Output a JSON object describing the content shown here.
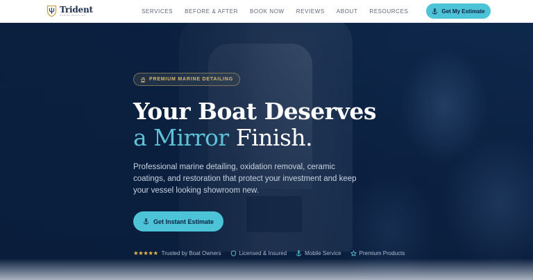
{
  "brand": {
    "name": "Trident",
    "tagline": "MARINE DETAILING"
  },
  "nav": {
    "items": [
      "SERVICES",
      "BEFORE & AFTER",
      "BOOK NOW",
      "REVIEWS",
      "ABOUT",
      "RESOURCES"
    ],
    "cta_label": "Get My Estimate"
  },
  "hero": {
    "badge": "PREMIUM MARINE DETAILING",
    "title_line1": "Your Boat Deserves",
    "title_line2_accent": "a Mirror",
    "title_line2_rest": " Finish.",
    "lead": "Professional marine detailing, oxidation removal, ceramic coatings, and restoration that protect your investment and keep your vessel looking showroom new.",
    "cta_label": "Get Instant Estimate",
    "stars": "★★★★★",
    "trust": [
      "Trusted by Boat Owners",
      "Licensed & Insured",
      "Mobile Service",
      "Premium Products"
    ]
  },
  "colors": {
    "accent": "#4cc3d6",
    "navy": "#0d2240",
    "gold": "#d9b56a"
  },
  "icons": {
    "logo": "trident-shield-icon",
    "anchor": "anchor-icon",
    "ship": "ship-icon",
    "shield": "shield-icon",
    "star": "star-icon"
  }
}
